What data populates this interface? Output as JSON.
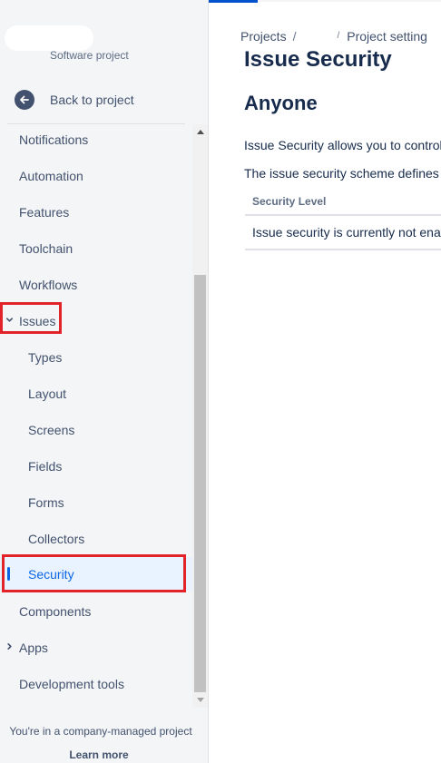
{
  "sidebar": {
    "project_type": "Software project",
    "back_label": "Back to project",
    "items": [
      {
        "label": "Notifications",
        "level": "top"
      },
      {
        "label": "Automation",
        "level": "top"
      },
      {
        "label": "Features",
        "level": "top"
      },
      {
        "label": "Toolchain",
        "level": "top"
      },
      {
        "label": "Workflows",
        "level": "top"
      },
      {
        "label": "Issues",
        "level": "top",
        "expanded": true
      },
      {
        "label": "Types",
        "level": "sub"
      },
      {
        "label": "Layout",
        "level": "sub"
      },
      {
        "label": "Screens",
        "level": "sub"
      },
      {
        "label": "Fields",
        "level": "sub"
      },
      {
        "label": "Forms",
        "level": "sub"
      },
      {
        "label": "Collectors",
        "level": "sub"
      },
      {
        "label": "Security",
        "level": "sub",
        "active": true
      },
      {
        "label": "Components",
        "level": "top"
      },
      {
        "label": "Apps",
        "level": "top",
        "expanded": false
      },
      {
        "label": "Development tools",
        "level": "top"
      }
    ],
    "footer_text": "You're in a company-managed project",
    "footer_link": "Learn more"
  },
  "main": {
    "breadcrumb": [
      "Projects",
      "/",
      "Project setting"
    ],
    "breadcrumb_sep2": "/",
    "title": "Issue Security",
    "scheme_name": "Anyone",
    "desc1": "Issue Security allows you to control",
    "desc2": "The issue security scheme defines h",
    "table": {
      "header": "Security Level",
      "row": "Issue security is currently not enab"
    }
  },
  "colors": {
    "accent": "#0c66e4",
    "highlight": "#e2232a",
    "sidebar_bg": "#f4f5f7"
  },
  "icons": {
    "back": "arrow-left-circle-icon",
    "expanded": "chevron-down-icon",
    "collapsed": "chevron-right-icon"
  }
}
